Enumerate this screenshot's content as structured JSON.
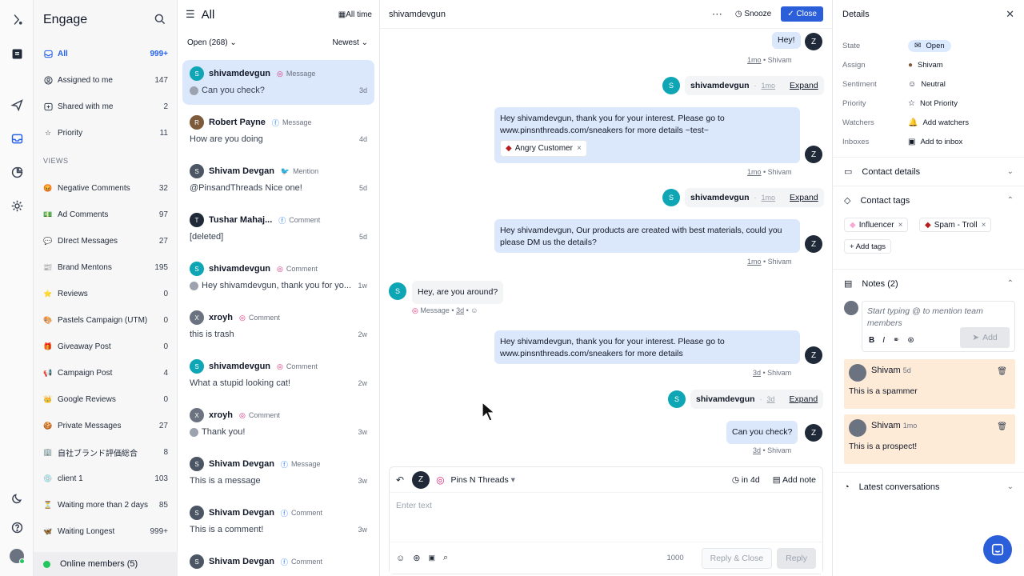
{
  "app": {
    "title": "Engage"
  },
  "sidebar": {
    "items": [
      {
        "label": "All",
        "count": "999+"
      },
      {
        "label": "Assigned to me",
        "count": "147"
      },
      {
        "label": "Shared with me",
        "count": "2"
      },
      {
        "label": "Priority",
        "count": "11"
      }
    ],
    "views_header": "VIEWS",
    "views": [
      {
        "label": "Negative Comments",
        "count": "32",
        "icon": "😡"
      },
      {
        "label": "Ad Comments",
        "count": "97",
        "icon": "💵"
      },
      {
        "label": "DIrect Messages",
        "count": "27",
        "icon": "💬"
      },
      {
        "label": "Brand Mentons",
        "count": "195",
        "icon": "📰"
      },
      {
        "label": "Reviews",
        "count": "0",
        "icon": "⭐"
      },
      {
        "label": "Pastels Campaign (UTM)",
        "count": "0",
        "icon": "🎨"
      },
      {
        "label": "Giveaway Post",
        "count": "0",
        "icon": "🎁"
      },
      {
        "label": "Campaign Post",
        "count": "4",
        "icon": "📢"
      },
      {
        "label": "Google Reviews",
        "count": "0",
        "icon": "👑"
      },
      {
        "label": "Private Messages",
        "count": "27",
        "icon": "🍪"
      },
      {
        "label": "自社ブランド評価総合",
        "count": "8",
        "icon": "🏢"
      },
      {
        "label": "client 1",
        "count": "103",
        "icon": "💿"
      },
      {
        "label": "Waiting more than 2 days",
        "count": "85",
        "icon": "⏳"
      },
      {
        "label": "Waiting Longest",
        "count": "999+",
        "icon": "🦋"
      }
    ],
    "online": "Online members (5)"
  },
  "list": {
    "title": "All",
    "time_filter": "All time",
    "filter": "Open (268)",
    "sort": "Newest",
    "conversations": [
      {
        "name": "shivamdevgun",
        "channel": "Message",
        "preview": "Can you check?",
        "time": "3d",
        "avatar": "S",
        "color": "#0ea5b5",
        "icon": "◎",
        "mini": true
      },
      {
        "name": "Robert Payne",
        "channel": "Message",
        "preview": "How are you doing",
        "time": "4d",
        "avatar": "R",
        "color": "#7c5a3a",
        "icon": "ⓕ",
        "mini": false
      },
      {
        "name": "Shivam Devgan",
        "channel": "Mention",
        "preview": "@PinsandThreads Nice one!",
        "time": "5d",
        "avatar": "S",
        "color": "#4b5563",
        "icon": "🐦",
        "mini": false
      },
      {
        "name": "Tushar Mahaj...",
        "channel": "Comment",
        "preview": "[deleted]",
        "time": "5d",
        "avatar": "T",
        "color": "#1f2937",
        "icon": "ⓕ",
        "mini": false
      },
      {
        "name": "shivamdevgun",
        "channel": "Comment",
        "preview": "Hey shivamdevgun, thank you for yo...",
        "time": "1w",
        "avatar": "S",
        "color": "#0ea5b5",
        "icon": "◎",
        "mini": true
      },
      {
        "name": "xroyh",
        "channel": "Comment",
        "preview": "this is trash",
        "time": "2w",
        "avatar": "X",
        "color": "#6b7280",
        "icon": "◎",
        "mini": false
      },
      {
        "name": "shivamdevgun",
        "channel": "Comment",
        "preview": "What a stupid looking cat!",
        "time": "2w",
        "avatar": "S",
        "color": "#0ea5b5",
        "icon": "◎",
        "mini": false
      },
      {
        "name": "xroyh",
        "channel": "Comment",
        "preview": "Thank you!",
        "time": "3w",
        "avatar": "X",
        "color": "#6b7280",
        "icon": "◎",
        "mini": true
      },
      {
        "name": "Shivam Devgan",
        "channel": "Message",
        "preview": "This is a message",
        "time": "3w",
        "avatar": "S",
        "color": "#4b5563",
        "icon": "ⓕ",
        "mini": false
      },
      {
        "name": "Shivam Devgan",
        "channel": "Comment",
        "preview": "This is a comment!",
        "time": "3w",
        "avatar": "S",
        "color": "#4b5563",
        "icon": "ⓕ",
        "mini": false
      },
      {
        "name": "Shivam Devgan",
        "channel": "Comment",
        "preview": "",
        "time": "",
        "avatar": "S",
        "color": "#4b5563",
        "icon": "ⓕ",
        "mini": false
      }
    ]
  },
  "chat": {
    "contact": "shivamdevgun",
    "snooze": "Snooze",
    "close": "Close",
    "msg_hey": "Hey!",
    "meta_1mo": "1mo",
    "meta_shivam": "Shivam",
    "assign_name": "shivamdevgun",
    "expand": "Expand",
    "msg1": "Hey shivamdevgun, thank you for your interest. Please go to www.pinsnthreads.com/sneakers for more details ~test~",
    "tag_angry": "Angry Customer",
    "msg2": "Hey shivamdevgun, Our products are created with best materials, could you please DM us the details?",
    "msg_in": "Hey, are you around?",
    "msg_in_channel": "Message",
    "meta_3d": "3d",
    "msg3": "Hey shivamdevgun, thank you for your interest. Please go to www.pinsnthreads.com/sneakers for more details",
    "msg4": "Can you check?",
    "composer": {
      "account": "Pins N Threads",
      "in": "in 4d",
      "add_note": "Add note",
      "placeholder": "Enter text",
      "count": "1000",
      "reply_close": "Reply & Close",
      "reply": "Reply"
    }
  },
  "details": {
    "title": "Details",
    "rows": [
      {
        "key": "State",
        "value": "Open",
        "icon": "✉"
      },
      {
        "key": "Assign",
        "value": "Shivam",
        "icon": "●"
      },
      {
        "key": "Sentiment",
        "value": "Neutral",
        "icon": "☺"
      },
      {
        "key": "Priority",
        "value": "Not Priority",
        "icon": "☆"
      },
      {
        "key": "Watchers",
        "value": "Add watchers",
        "icon": "🔔"
      },
      {
        "key": "Inboxes",
        "value": "Add to inbox",
        "icon": "▣"
      }
    ],
    "contact_details": "Contact details",
    "contact_tags": "Contact tags",
    "tags": [
      "Influencer",
      "Spam - Troll"
    ],
    "add_tags": "Add tags",
    "notes_title": "Notes (2)",
    "note_placeholder": "Start typing @ to mention team members",
    "note_add": "Add",
    "notes": [
      {
        "author": "Shivam",
        "age": "5d",
        "text": "This is a spammer"
      },
      {
        "author": "Shivam",
        "age": "1mo",
        "text": "This is a prospect!"
      }
    ],
    "latest": "Latest conversations"
  }
}
